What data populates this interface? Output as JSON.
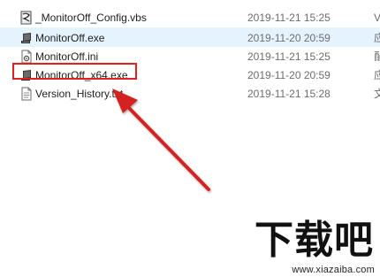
{
  "files": [
    {
      "name": "_MonitorOff_Config.vbs",
      "date": "2019-11-21 15:25",
      "type": "V",
      "icon": "vbs-script-icon",
      "selected": false
    },
    {
      "name": "MonitorOff.exe",
      "date": "2019-11-20 20:59",
      "type": "应",
      "icon": "exe-app-icon",
      "selected": true
    },
    {
      "name": "MonitorOff.ini",
      "date": "2019-11-21 15:25",
      "type": "配",
      "icon": "ini-config-icon",
      "selected": false
    },
    {
      "name": "MonitorOff_x64.exe",
      "date": "2019-11-20 20:59",
      "type": "应",
      "icon": "exe-app-icon",
      "selected": false
    },
    {
      "name": "Version_History.txt",
      "date": "2019-11-21 15:28",
      "type": "文",
      "icon": "txt-file-icon",
      "selected": false
    }
  ],
  "annotation": {
    "highlight_color": "#e02020",
    "arrow_color": "#d42020"
  },
  "watermark": {
    "logo_text": "下载吧",
    "url": "www.xiazaiba.com"
  },
  "colors": {
    "selected_row": "#e5f3ff",
    "secondary_text": "#6d6d6d"
  }
}
